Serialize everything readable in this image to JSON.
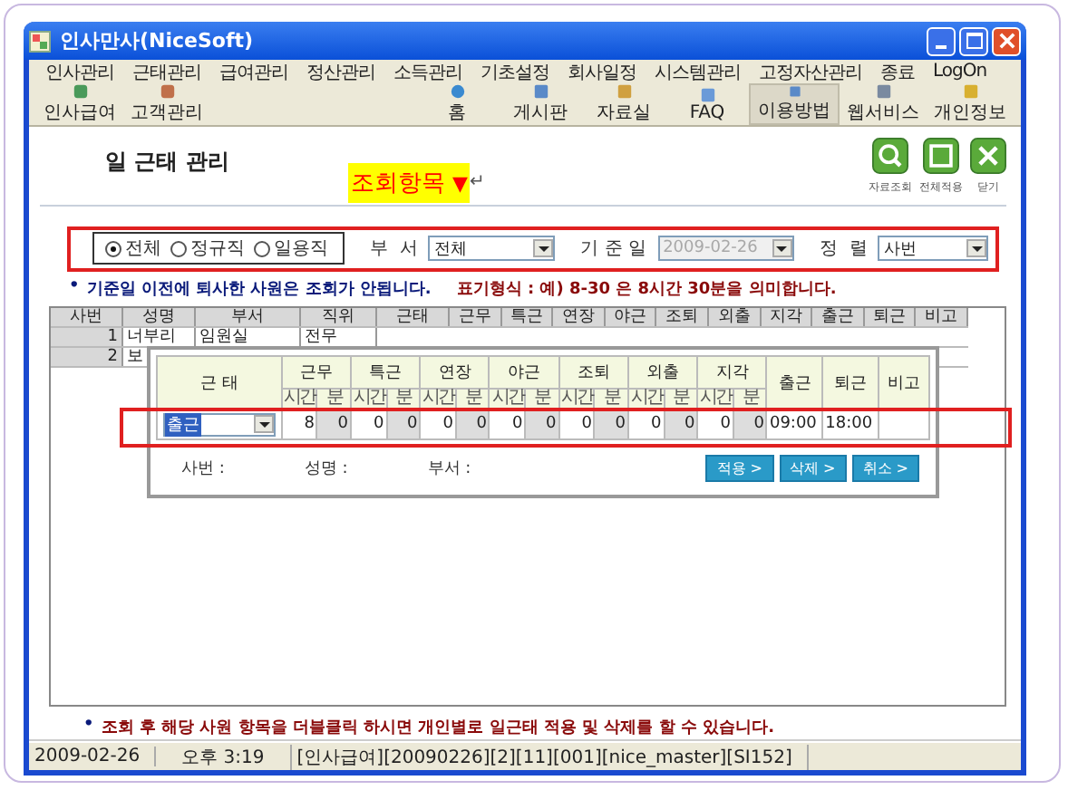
{
  "window": {
    "title": "인사만사(NiceSoft)"
  },
  "menu": [
    "인사관리",
    "근태관리",
    "급여관리",
    "정산관리",
    "소득관리",
    "기초설정",
    "회사일정",
    "시스템관리",
    "고정자산관리",
    "종료",
    "LogOn"
  ],
  "toolbar": {
    "left": [
      {
        "label": "인사급여",
        "kind": "card",
        "selected": false
      },
      {
        "label": "고객관리",
        "kind": "person",
        "selected": false
      }
    ],
    "right": [
      {
        "label": "홈",
        "kind": "globe",
        "selected": false
      },
      {
        "label": "게시판",
        "kind": "board",
        "selected": false
      },
      {
        "label": "자료실",
        "kind": "box",
        "selected": false
      },
      {
        "label": "FAQ",
        "kind": "chat",
        "selected": false
      },
      {
        "label": "이용방법",
        "kind": "board",
        "selected": true
      },
      {
        "label": "웹서비스",
        "kind": "monitor",
        "selected": false
      },
      {
        "label": "개인정보",
        "kind": "key",
        "selected": false
      }
    ]
  },
  "page_title": "일 근태 관리",
  "annotation": {
    "text": "조회항목",
    "arrow": "▼",
    "return_mark": "↵"
  },
  "actions": [
    {
      "label": "자료조회",
      "kind": "search"
    },
    {
      "label": "전체적용",
      "kind": "window"
    },
    {
      "label": "닫기",
      "kind": "close"
    }
  ],
  "filter": {
    "employment": [
      {
        "label": "전체",
        "selected": true
      },
      {
        "label": "정규직",
        "selected": false
      },
      {
        "label": "일용직",
        "selected": false
      }
    ],
    "department": {
      "label": "부  서",
      "value": "전체"
    },
    "base_date": {
      "label": "기 준 일",
      "value": "2009-02-26",
      "disabled": true
    },
    "sort": {
      "label": "정  렬",
      "value": "사번"
    }
  },
  "notice": {
    "bullet": "•",
    "text": "기준일 이전에 퇴사한 사원은 조회가 안됩니다.",
    "format": "표기형식 : 예) 8-30 은 8시간 30분을 의미합니다."
  },
  "grid": {
    "columns": [
      "사번",
      "성명",
      "부서",
      "직위",
      "근태",
      "근무",
      "특근",
      "연장",
      "야근",
      "조퇴",
      "외출",
      "지각",
      "출근",
      "퇴근",
      "비고"
    ],
    "rows": [
      {
        "no": "1",
        "name": "너부리",
        "dept": "임원실",
        "position": "전무"
      },
      {
        "no": "2",
        "name": "보"
      }
    ]
  },
  "popup": {
    "first_header": "근 태",
    "groups": [
      {
        "label": "근무",
        "sub": [
          "시간",
          "분"
        ]
      },
      {
        "label": "특근",
        "sub": [
          "시간",
          "분"
        ]
      },
      {
        "label": "연장",
        "sub": [
          "시간",
          "분"
        ]
      },
      {
        "label": "야근",
        "sub": [
          "시간",
          "분"
        ]
      },
      {
        "label": "조퇴",
        "sub": [
          "시간",
          "분"
        ]
      },
      {
        "label": "외출",
        "sub": [
          "시간",
          "분"
        ]
      },
      {
        "label": "지각",
        "sub": [
          "시간",
          "분"
        ]
      }
    ],
    "tail_headers": [
      "출근",
      "퇴근",
      "비고"
    ],
    "row": {
      "status": "출근",
      "pairs": [
        [
          "8",
          "0"
        ],
        [
          "0",
          "0"
        ],
        [
          "0",
          "0"
        ],
        [
          "0",
          "0"
        ],
        [
          "0",
          "0"
        ],
        [
          "0",
          "0"
        ],
        [
          "0",
          "0"
        ]
      ],
      "tail": [
        "09:00",
        "18:00"
      ]
    },
    "footer_labels": [
      "사번 :",
      "성명 :",
      "부서 :"
    ],
    "buttons": [
      "적용 >",
      "삭제 >",
      "취소 >"
    ]
  },
  "bottom_notice": {
    "bullet": "•",
    "text": "조회 후 해당 사원 항목을 더블클릭 하시면 개인별로 일근태 적용 및 삭제를 할 수 있습니다."
  },
  "status_bar": [
    "2009-02-26",
    "오후 3:19",
    "[인사급여][20090226][2][11][001][nice_master][SI152]"
  ]
}
